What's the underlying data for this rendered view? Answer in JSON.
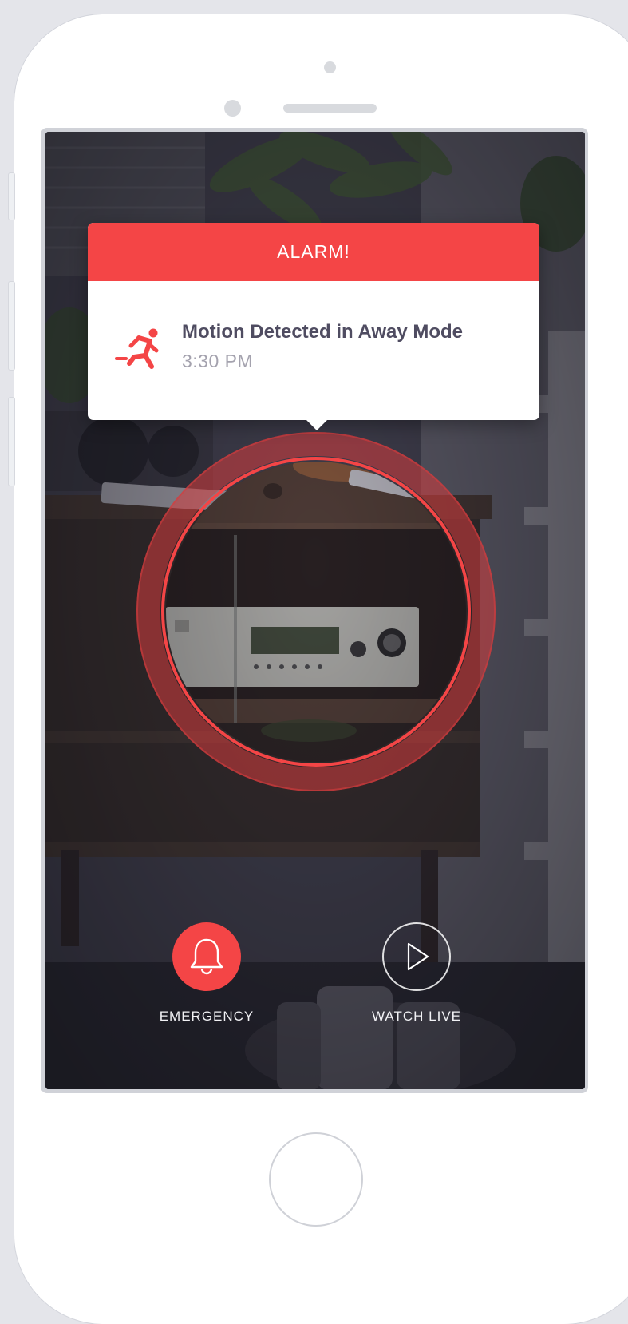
{
  "alert": {
    "header": "ALARM!",
    "title": "Motion Detected in Away Mode",
    "time": "3:30 PM",
    "icon": "running-person-icon"
  },
  "actions": {
    "emergency": {
      "label": "EMERGENCY",
      "icon": "bell-icon"
    },
    "watch_live": {
      "label": "WATCH LIVE",
      "icon": "play-icon"
    }
  },
  "colors": {
    "accent": "#f44546",
    "title_text": "#4f4c61",
    "subtitle_text": "#a4a2ae"
  }
}
